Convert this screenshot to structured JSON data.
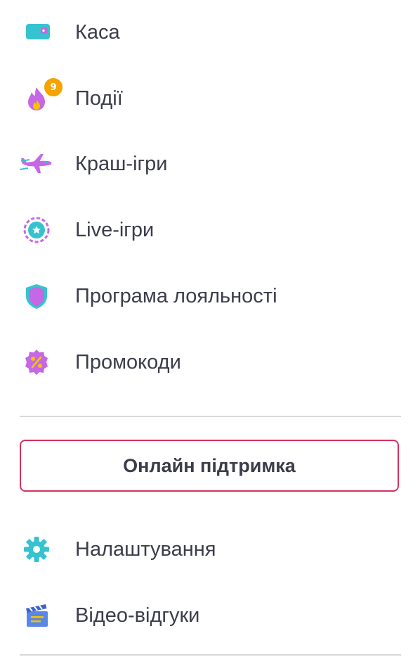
{
  "menu": {
    "items": [
      {
        "label": "Каса",
        "icon": "wallet-icon"
      },
      {
        "label": "Події",
        "icon": "fire-icon",
        "badge": "9"
      },
      {
        "label": "Краш-ігри",
        "icon": "airplane-icon"
      },
      {
        "label": "Live-ігри",
        "icon": "live-chip-icon"
      },
      {
        "label": "Програма лояльності",
        "icon": "shield-icon"
      },
      {
        "label": "Промокоди",
        "icon": "percent-badge-icon"
      }
    ]
  },
  "support": {
    "label": "Онлайн підтримка",
    "border_color": "#d6315c"
  },
  "secondary_menu": {
    "items": [
      {
        "label": "Налаштування",
        "icon": "gear-icon"
      },
      {
        "label": "Відео-відгуки",
        "icon": "clapperboard-icon"
      }
    ]
  },
  "colors": {
    "accent_teal": "#36c3cf",
    "accent_purple": "#c667e6",
    "badge_orange": "#f5a300",
    "text": "#3b3d4b"
  }
}
